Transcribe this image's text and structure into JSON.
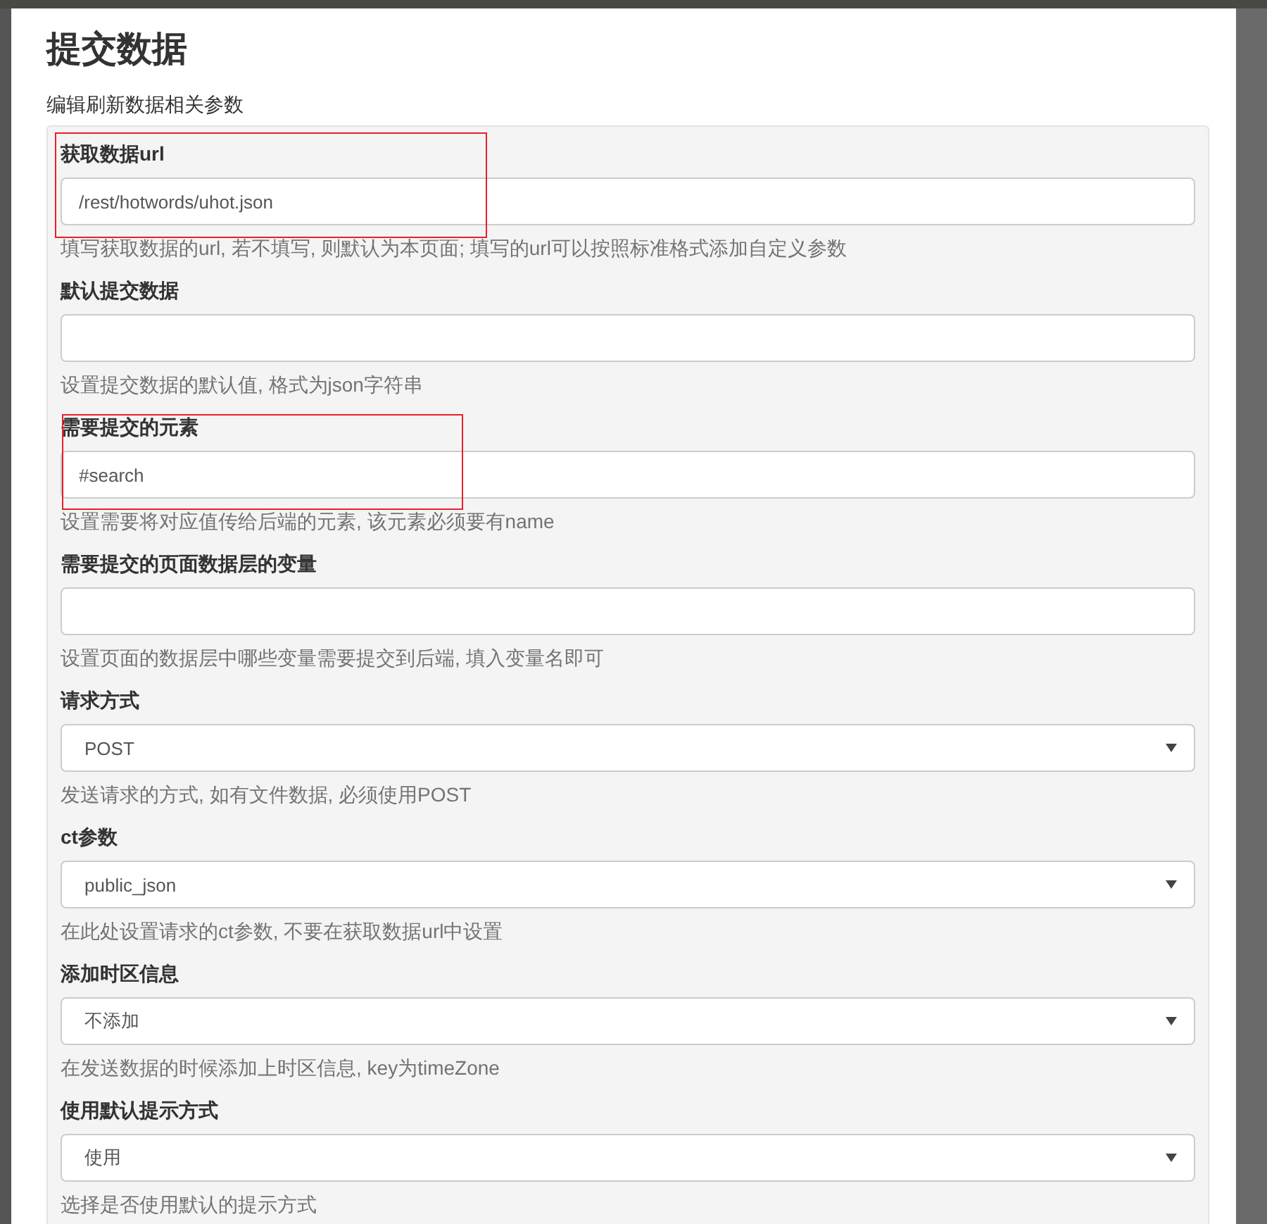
{
  "dialog": {
    "title": "提交数据",
    "subtitle": "编辑刷新数据相关参数"
  },
  "fields": [
    {
      "kind": "text",
      "label": "获取数据url",
      "value": "/rest/hotwords/uhot.json",
      "help": "填写获取数据的url, 若不填写, 则默认为本页面; 填写的url可以按照标准格式添加自定义参数",
      "highlighted": true
    },
    {
      "kind": "text",
      "label": "默认提交数据",
      "help": "设置提交数据的默认值, 格式为json字符串",
      "highlighted": false
    },
    {
      "kind": "text",
      "label": "需要提交的元素",
      "value": "#search",
      "help": "设置需要将对应值传给后端的元素, 该元素必须要有name",
      "highlighted": true
    },
    {
      "kind": "text",
      "label": "需要提交的页面数据层的变量",
      "help": "设置页面的数据层中哪些变量需要提交到后端, 填入变量名即可",
      "highlighted": false
    },
    {
      "kind": "select",
      "label": "请求方式",
      "value": "POST",
      "help": "发送请求的方式, 如有文件数据, 必须使用POST",
      "highlighted": false
    },
    {
      "kind": "select",
      "label": "ct参数",
      "value": "public_json",
      "help": "在此处设置请求的ct参数, 不要在获取数据url中设置",
      "highlighted": false
    },
    {
      "kind": "select",
      "label": "添加时区信息",
      "value": "不添加",
      "help": "在发送数据的时候添加上时区信息, key为timeZone",
      "highlighted": false
    },
    {
      "kind": "select",
      "label": "使用默认提示方式",
      "value": "使用",
      "help": "选择是否使用默认的提示方式",
      "highlighted": false
    }
  ]
}
